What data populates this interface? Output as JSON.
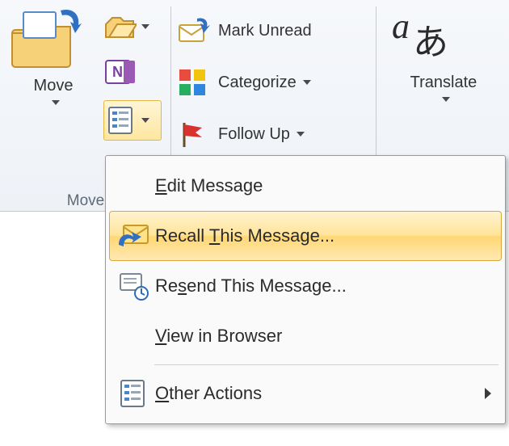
{
  "ribbon": {
    "move": {
      "label": "Move",
      "group_label": "Move"
    },
    "tags": {
      "mark_unread": "Mark Unread",
      "categorize": "Categorize",
      "follow_up": "Follow Up"
    },
    "translate": {
      "label": "Translate"
    }
  },
  "menu": {
    "edit": "Edit Message",
    "recall": "Recall This Message...",
    "resend": "Resend This Message...",
    "view": "View in Browser",
    "other": "Other Actions"
  }
}
